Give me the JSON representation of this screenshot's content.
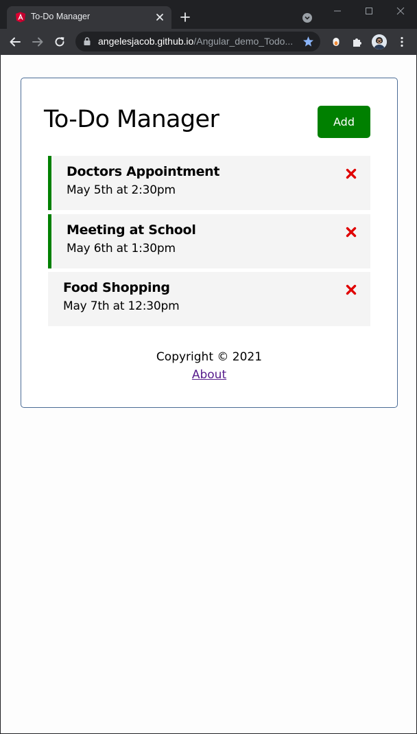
{
  "browser": {
    "tab_title": "To-Do Manager",
    "url_host": "angelesjacob.github.io",
    "url_path": "/Angular_demo_Todo..."
  },
  "app": {
    "title": "To-Do Manager",
    "add_label": "Add"
  },
  "tasks": [
    {
      "text": "Doctors Appointment",
      "day": "May 5th at 2:30pm",
      "reminder": true
    },
    {
      "text": "Meeting at School",
      "day": "May 6th at 1:30pm",
      "reminder": true
    },
    {
      "text": "Food Shopping",
      "day": "May 7th at 12:30pm",
      "reminder": false
    }
  ],
  "footer": {
    "copyright": "Copyright © 2021",
    "about_label": "About"
  },
  "colors": {
    "accent": "#008000",
    "delete": "#e00000",
    "task_bg": "#f4f4f4",
    "link": "#551a8b",
    "container_border": "#4a6b95"
  },
  "icons": {
    "favicon": "angular-icon",
    "delete": "close-x-icon"
  }
}
